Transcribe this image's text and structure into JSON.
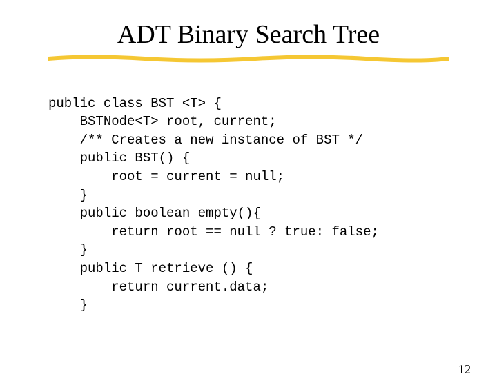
{
  "title": "ADT Binary Search Tree",
  "code": {
    "l1": "public class BST <T> {",
    "l2": "    BSTNode<T> root, current;",
    "l3": "    /** Creates a new instance of BST */",
    "l4": "    public BST() {",
    "l5": "        root = current = null;",
    "l6": "    }",
    "l7": "    public boolean empty(){",
    "l8": "        return root == null ? true: false;",
    "l9": "    }",
    "l10": "    public T retrieve () {",
    "l11": "        return current.data;",
    "l12": "    }"
  },
  "page_number": "12"
}
